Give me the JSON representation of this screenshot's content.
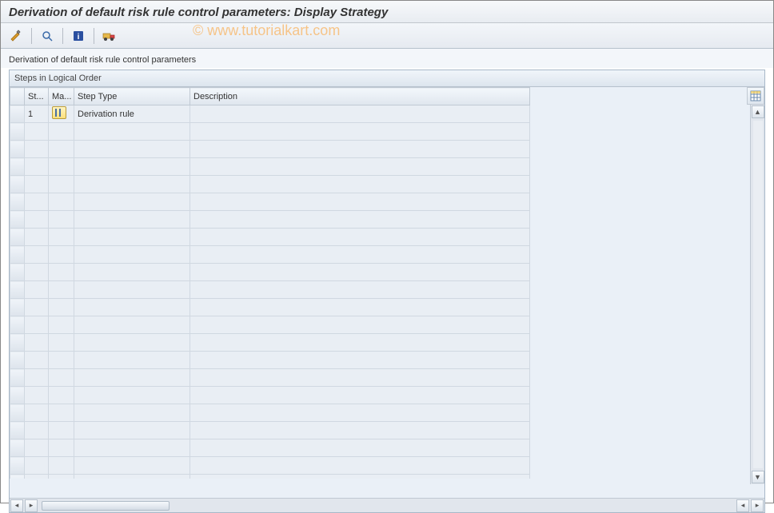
{
  "title": "Derivation of default risk rule control parameters: Display Strategy",
  "watermark": "© www.tutorialkart.com",
  "toolbar": {
    "change_icon": "change-icon",
    "inspect_icon": "inspect-icon",
    "info_icon": "info-icon",
    "transport_icon": "transport-icon"
  },
  "subtitle": "Derivation of default risk rule control parameters",
  "panel": {
    "header": "Steps in Logical Order",
    "columns": {
      "step_no": "St...",
      "maint": "Ma...",
      "step_type": "Step Type",
      "description": "Description"
    },
    "rows": [
      {
        "step_no": "1",
        "maint_icon": "grid-icon",
        "step_type": "Derivation rule",
        "description": ""
      }
    ],
    "empty_rows": 22
  }
}
